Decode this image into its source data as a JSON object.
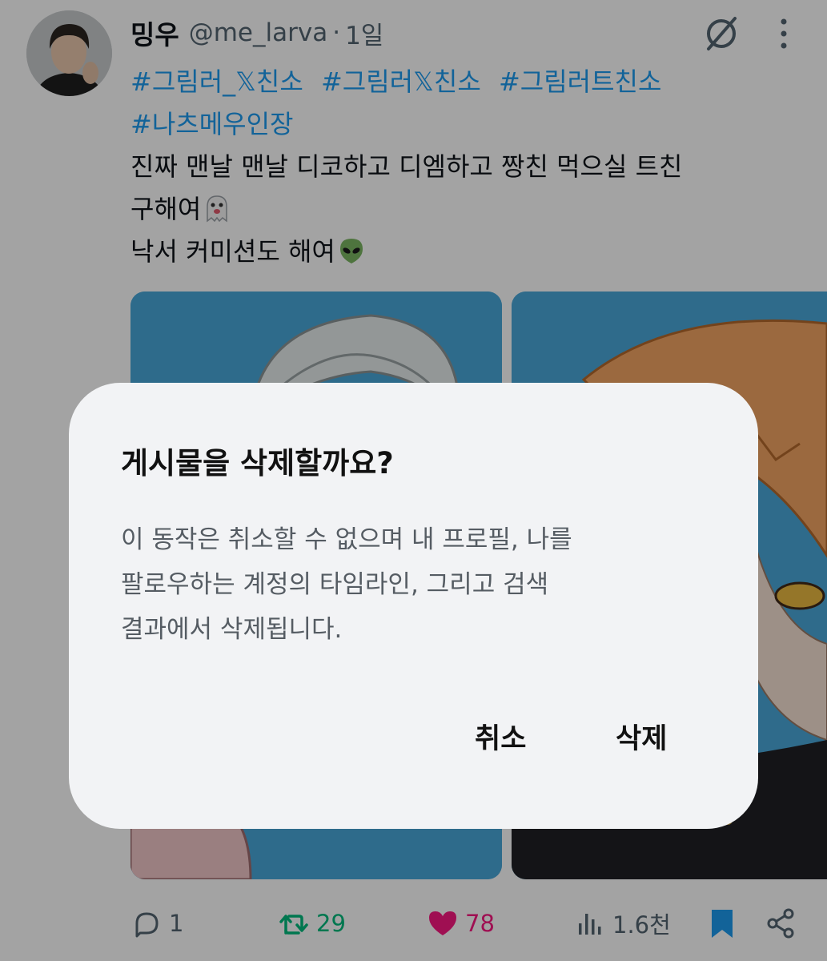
{
  "tweet": {
    "display_name": "밍우",
    "handle": "@me_larva",
    "separator": "·",
    "time": "1일",
    "hashtags": [
      "#그림러_𝕏친소",
      "#그림러𝕏친소",
      "#그림러트친소",
      "#나츠메우인장"
    ],
    "lines": [
      "진짜 맨날 맨날 디코하고 디엠하고 짱친 먹으실 트친",
      "구해여",
      "낙서 커미션도 해여"
    ],
    "emoji_line2": "ghost-emoji",
    "emoji_line3": "alien-emoji"
  },
  "actions": {
    "replies": "1",
    "retweets": "29",
    "likes": "78",
    "views": "1.6천"
  },
  "icons": [
    "grok-icon",
    "more-vertical-icon",
    "reply-icon",
    "retweet-icon",
    "heart-icon",
    "views-icon",
    "bookmark-icon",
    "share-icon"
  ],
  "colors": {
    "accent": "#1d9bf0",
    "retweet": "#00ba7c",
    "like": "#f91880",
    "bookmark": "#1d9bf0"
  },
  "dialog": {
    "title": "게시물을 삭제할까요?",
    "body_lines": [
      "이 동작은 취소할 수 없으며 내 프로필, 나를",
      "팔로우하는 계정의 타임라인, 그리고 검색",
      "결과에서 삭제됩니다."
    ],
    "cancel_label": "취소",
    "delete_label": "삭제"
  }
}
